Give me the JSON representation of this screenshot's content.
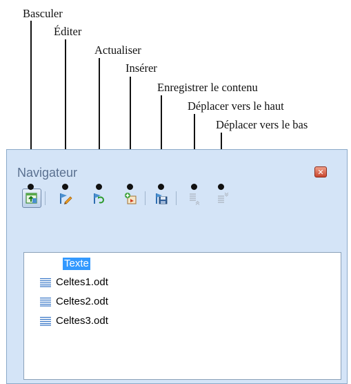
{
  "callouts": {
    "toggle": "Basculer",
    "edit": "Éditer",
    "update": "Actualiser",
    "insert": "Insérer",
    "save_contents": "Enregistrer le contenu",
    "move_up": "Déplacer vers le haut",
    "move_down": "Déplacer vers le bas"
  },
  "navigator": {
    "title": "Navigateur",
    "close_glyph": "✕",
    "toolbar": [
      {
        "id": "toggle",
        "icon": "toggle-master-view-icon",
        "active": true,
        "enabled": true
      },
      {
        "id": "edit",
        "icon": "edit-icon",
        "active": false,
        "enabled": true
      },
      {
        "id": "update",
        "icon": "update-icon",
        "active": false,
        "enabled": true
      },
      {
        "id": "insert",
        "icon": "insert-icon",
        "active": false,
        "enabled": true
      },
      {
        "id": "save_contents",
        "icon": "save-contents-icon",
        "active": false,
        "enabled": true
      },
      {
        "id": "move_up",
        "icon": "move-up-icon",
        "active": false,
        "enabled": false
      },
      {
        "id": "move_down",
        "icon": "move-down-icon",
        "active": false,
        "enabled": false
      }
    ],
    "tree": {
      "root": "Texte",
      "items": [
        "Celtes1.odt",
        "Celtes2.odt",
        "Celtes3.odt"
      ]
    }
  },
  "colors": {
    "panel_bg": "#d4e4f7",
    "selection": "#3399ff",
    "close_button": "#c8452e"
  }
}
